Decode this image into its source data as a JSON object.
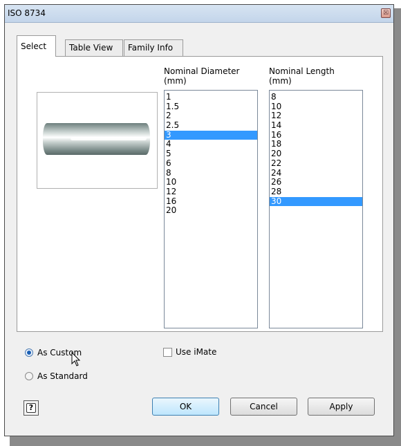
{
  "window": {
    "title": "ISO 8734",
    "close_glyph": "☒"
  },
  "tabs": [
    {
      "label": "Select",
      "active": true
    },
    {
      "label": "Table View",
      "active": false
    },
    {
      "label": "Family Info",
      "active": false
    }
  ],
  "preview": {
    "icon": "cylindrical-pin-preview"
  },
  "diameter": {
    "label_line1": "Nominal Diameter",
    "label_line2": "(mm)",
    "items": [
      "1",
      "1.5",
      "2",
      "2.5",
      "3",
      "4",
      "5",
      "6",
      "8",
      "10",
      "12",
      "16",
      "20"
    ],
    "selected": "3"
  },
  "length": {
    "label_line1": "Nominal Length",
    "label_line2": "(mm)",
    "items": [
      "8",
      "10",
      "12",
      "14",
      "16",
      "18",
      "20",
      "22",
      "24",
      "26",
      "28",
      "30"
    ],
    "selected": "30"
  },
  "options": {
    "as_custom": "As Custom",
    "as_standard": "As Standard",
    "use_imate": "Use iMate",
    "selected_mode": "as_custom",
    "use_imate_checked": false
  },
  "buttons": {
    "help": "?",
    "ok": "OK",
    "cancel": "Cancel",
    "apply": "Apply"
  },
  "colors": {
    "selection": "#3399ff",
    "title_bar": "#c3d5ea"
  }
}
